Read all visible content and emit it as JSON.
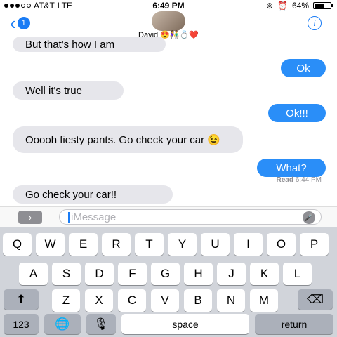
{
  "status": {
    "carrier": "AT&T",
    "network": "LTE",
    "time": "6:49 PM",
    "battery": "64%",
    "battery_level": 0.64
  },
  "header": {
    "back_count": "1",
    "contact_name": "David 😍👫💍❤️",
    "back_icon": "chevron-left-icon",
    "info_icon": "info-icon"
  },
  "messages": [
    {
      "direction": "incoming",
      "text": "But that's how I am"
    },
    {
      "direction": "outgoing",
      "text": "Ok"
    },
    {
      "direction": "incoming",
      "text": "Well it's true"
    },
    {
      "direction": "outgoing",
      "text": "Ok!!!"
    },
    {
      "direction": "incoming",
      "text": "Ooooh fiesty pants. Go check your car 😉"
    },
    {
      "direction": "outgoing",
      "text": "What?"
    },
    {
      "direction": "incoming",
      "text": "Go check your car!!"
    }
  ],
  "read_receipt": {
    "label": "Read",
    "time": "6:44 PM"
  },
  "input": {
    "placeholder": "iMessage"
  },
  "keyboard": {
    "row1": [
      "Q",
      "W",
      "E",
      "R",
      "T",
      "Y",
      "U",
      "I",
      "O",
      "P"
    ],
    "row2": [
      "A",
      "S",
      "D",
      "F",
      "G",
      "H",
      "J",
      "K",
      "L"
    ],
    "row3": [
      "Z",
      "X",
      "C",
      "V",
      "B",
      "N",
      "M"
    ],
    "numbers_label": "123",
    "space_label": "space",
    "return_label": "return"
  },
  "colors": {
    "accent": "#1a7cf5",
    "outgoing_bubble": "#2a8ef8",
    "incoming_bubble": "#e6e6eb"
  }
}
